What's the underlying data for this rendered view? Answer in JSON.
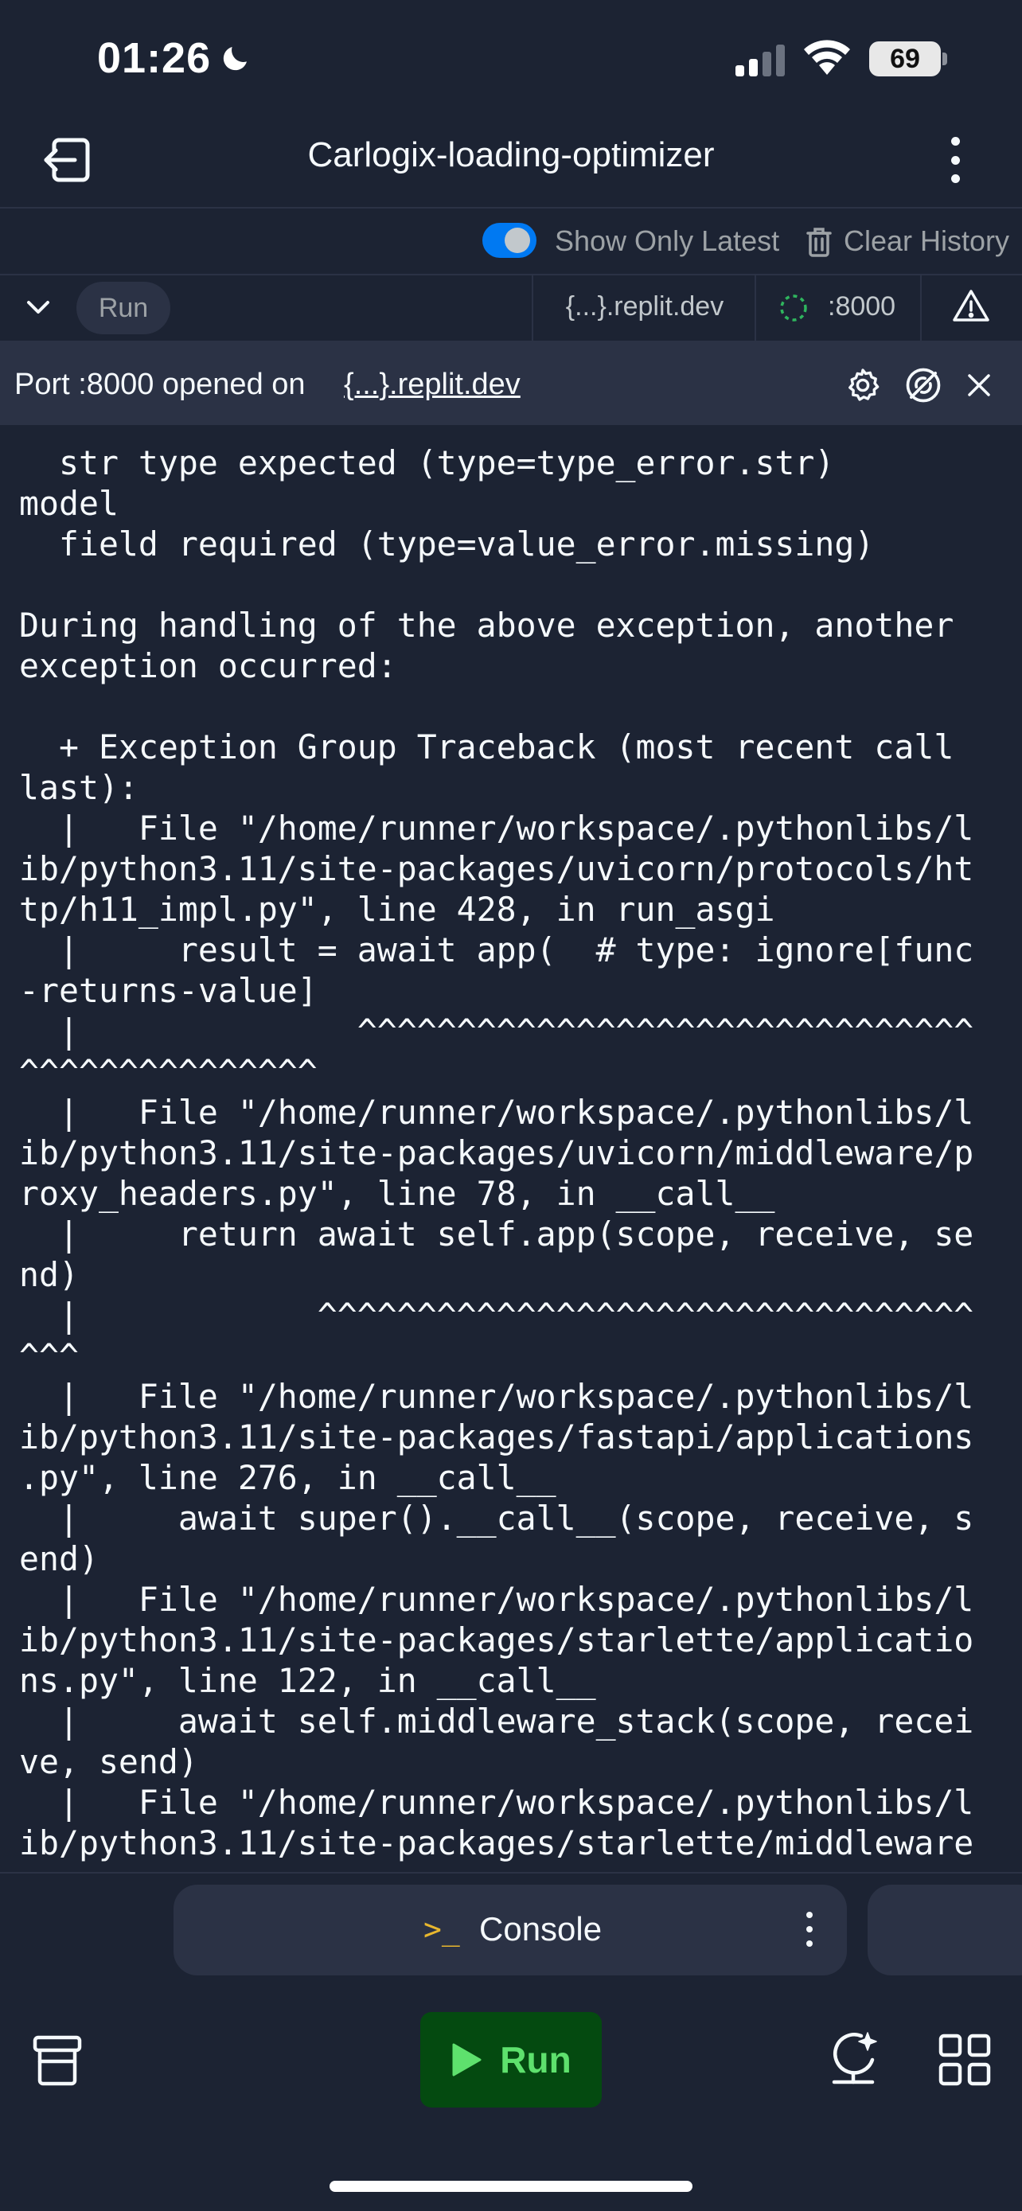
{
  "status_bar": {
    "time": "01:26",
    "battery": "69"
  },
  "header": {
    "title": "Carlogix-loading-optimizer"
  },
  "history": {
    "show_only_latest": "Show Only Latest",
    "toggle_on": true,
    "clear_history": "Clear History"
  },
  "toolbar": {
    "run_pill": "Run",
    "domain": "{...}.replit.dev",
    "port": ":8000"
  },
  "port_banner": {
    "text": "Port :8000 opened on ",
    "link": "{...}.replit.dev"
  },
  "console": {
    "lines": [
      "  str type expected (type=type_error.str)",
      "model",
      "  field required (type=value_error.missing)",
      "",
      "During handling of the above exception, another",
      "exception occurred:",
      "",
      "  + Exception Group Traceback (most recent call",
      "last):",
      "  |   File \"/home/runner/workspace/.pythonlibs/l",
      "ib/python3.11/site-packages/uvicorn/protocols/ht",
      "tp/h11_impl.py\", line 428, in run_asgi",
      "  |     result = await app(  # type: ignore[func",
      "-returns-value]",
      "  |              ^^^^^^^^^^^^^^^^^^^^^^^^^^^^^^^",
      "^^^^^^^^^^^^^^^",
      "  |   File \"/home/runner/workspace/.pythonlibs/l",
      "ib/python3.11/site-packages/uvicorn/middleware/p",
      "roxy_headers.py\", line 78, in __call__",
      "  |     return await self.app(scope, receive, se",
      "nd)",
      "  |            ^^^^^^^^^^^^^^^^^^^^^^^^^^^^^^^^^",
      "^^^",
      "  |   File \"/home/runner/workspace/.pythonlibs/l",
      "ib/python3.11/site-packages/fastapi/applications",
      ".py\", line 276, in __call__",
      "  |     await super().__call__(scope, receive, s",
      "end)",
      "  |   File \"/home/runner/workspace/.pythonlibs/l",
      "ib/python3.11/site-packages/starlette/applicatio",
      "ns.py\", line 122, in __call__",
      "  |     await self.middleware_stack(scope, recei",
      "ve, send)",
      "  |   File \"/home/runner/workspace/.pythonlibs/l",
      "ib/python3.11/site-packages/starlette/middleware"
    ]
  },
  "console_tab": {
    "prompt": ">_",
    "label": "Console"
  },
  "bottom_nav": {
    "run_label": "Run"
  },
  "colors": {
    "background": "#1c2333",
    "surface": "#2b3245",
    "accent": "#0079f2",
    "run_green": "#5ee16d",
    "run_bg": "#044a10",
    "prompt_yellow": "#e8b72e"
  },
  "icons": [
    "moon-icon",
    "signal-icon",
    "wifi-icon",
    "exit-icon",
    "more-vertical-icon",
    "trash-icon",
    "chevron-down-icon",
    "loader-icon",
    "warning-icon",
    "gear-icon",
    "eye-off-icon",
    "close-icon",
    "layers-icon",
    "play-icon",
    "ai-assistant-icon",
    "grid-icon"
  ]
}
